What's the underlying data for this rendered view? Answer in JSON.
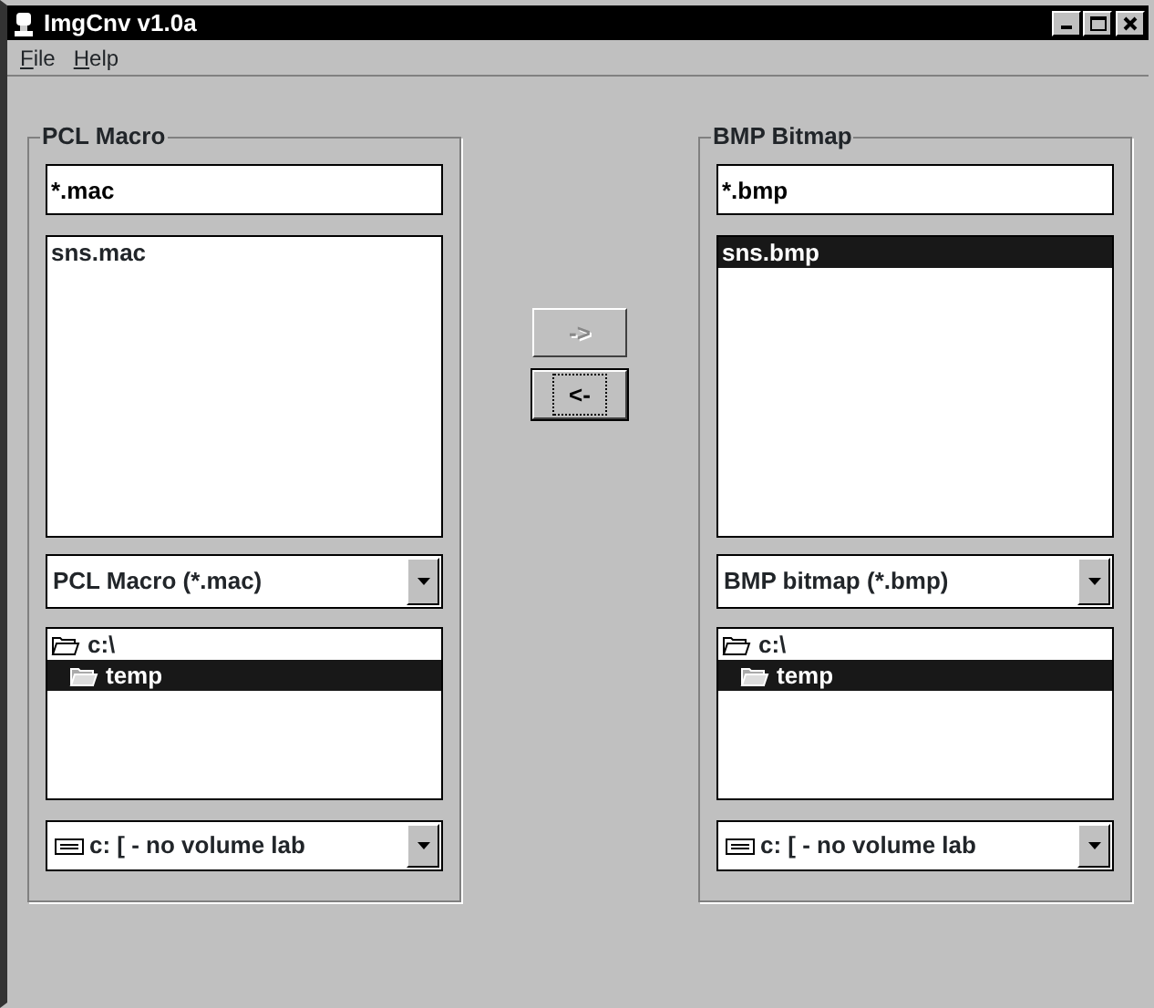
{
  "window": {
    "title": "ImgCnv v1.0a"
  },
  "menu": [
    {
      "label": "File"
    },
    {
      "label": "Help"
    }
  ],
  "panels": [
    {
      "title": "PCL Macro",
      "filter": "*.mac",
      "files": [
        {
          "name": "sns.mac",
          "selected": false
        }
      ],
      "file_type": "PCL Macro (*.mac)",
      "folders": [
        {
          "name": "c:\\",
          "selected": false,
          "children": [
            {
              "name": "temp",
              "selected": true
            }
          ]
        }
      ],
      "drive": "c: [ - no volume lab"
    },
    {
      "title": "BMP Bitmap",
      "filter": "*.bmp",
      "files": [
        {
          "name": "sns.bmp",
          "selected": true
        }
      ],
      "file_type": "BMP bitmap (*.bmp)",
      "folders": [
        {
          "name": "c:\\",
          "selected": false,
          "children": [
            {
              "name": "temp",
              "selected": true
            }
          ]
        }
      ],
      "drive": "c: [ - no volume lab"
    }
  ],
  "buttons": [
    {
      "label": "->",
      "disabled": true,
      "focused": false
    },
    {
      "label": "<-",
      "disabled": false,
      "focused": true
    }
  ]
}
